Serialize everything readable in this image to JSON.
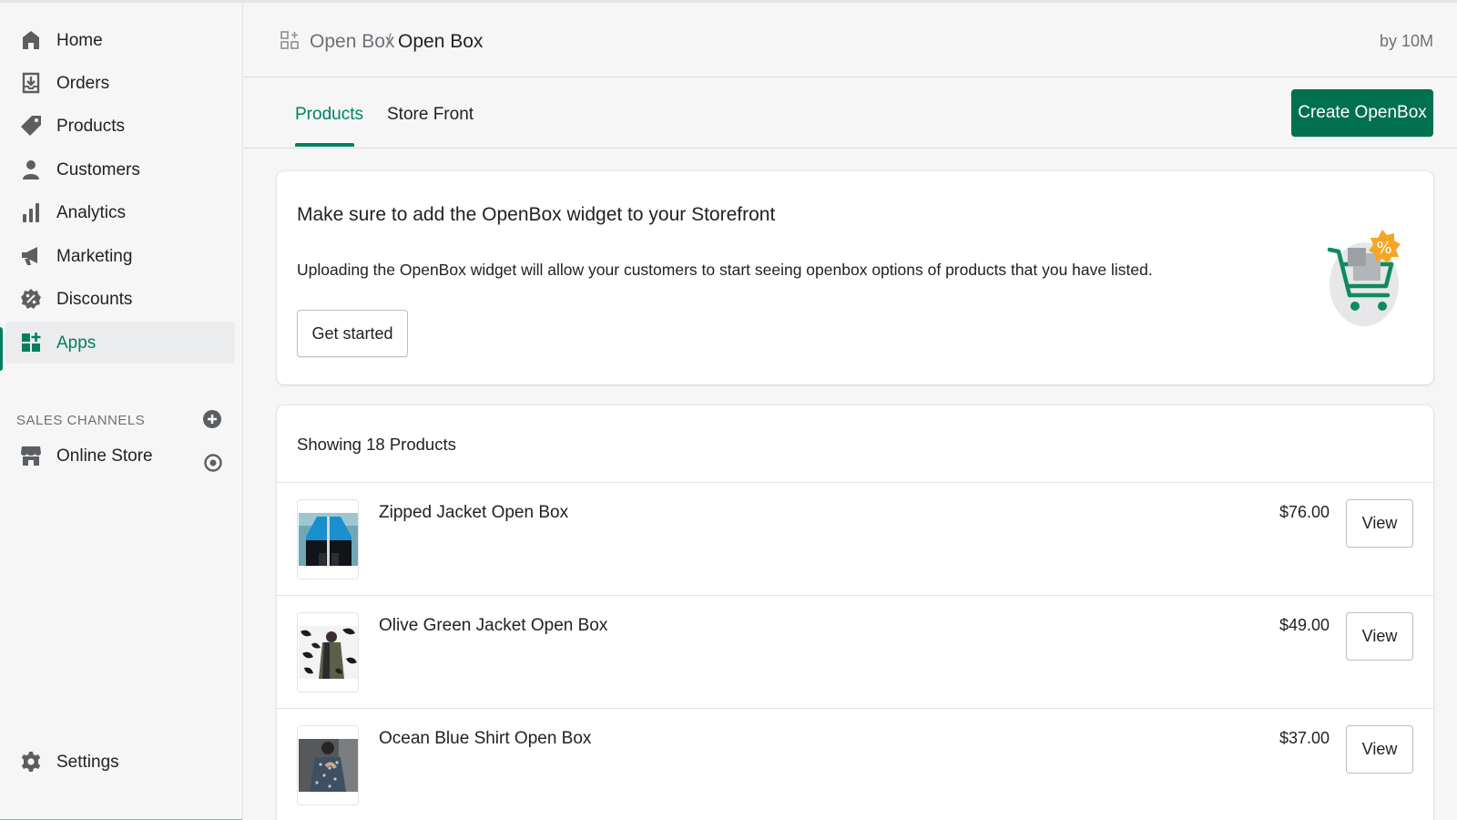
{
  "sidebar": {
    "items": [
      {
        "label": "Home",
        "icon": "home-icon"
      },
      {
        "label": "Orders",
        "icon": "orders-icon"
      },
      {
        "label": "Products",
        "icon": "tag-icon"
      },
      {
        "label": "Customers",
        "icon": "person-icon"
      },
      {
        "label": "Analytics",
        "icon": "bar-chart-icon"
      },
      {
        "label": "Marketing",
        "icon": "megaphone-icon"
      },
      {
        "label": "Discounts",
        "icon": "discount-icon"
      },
      {
        "label": "Apps",
        "icon": "apps-icon",
        "active": true
      }
    ],
    "sales_channels_heading": "SALES CHANNELS",
    "channels": [
      {
        "label": "Online Store",
        "icon": "store-icon"
      }
    ],
    "settings_label": "Settings"
  },
  "header": {
    "breadcrumb": [
      "Open Box",
      "Open Box"
    ],
    "separator": "/",
    "byline": "by 10M"
  },
  "tabs": [
    {
      "label": "Products",
      "active": true
    },
    {
      "label": "Store Front",
      "active": false
    }
  ],
  "create_button": "Create OpenBox",
  "banner": {
    "title": "Make sure to add the OpenBox widget to your Storefront",
    "text": "Uploading the OpenBox widget will allow your customers to start seeing openbox options of products that you have listed.",
    "button": "Get started",
    "badge_symbol": "%"
  },
  "products": {
    "showing": "Showing 18 Products",
    "items": [
      {
        "name": "Zipped Jacket Open Box",
        "price": "$76.00",
        "action": "View"
      },
      {
        "name": "Olive Green Jacket Open Box",
        "price": "$49.00",
        "action": "View"
      },
      {
        "name": "Ocean Blue Shirt Open Box",
        "price": "$37.00",
        "action": "View"
      }
    ]
  },
  "colors": {
    "accent": "#008060",
    "primary_button": "#00704f",
    "badge": "#f5a623"
  }
}
